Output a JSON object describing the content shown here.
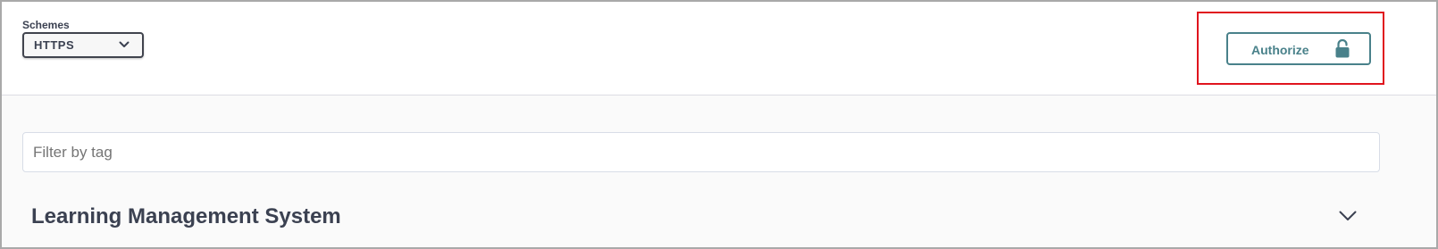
{
  "schemes": {
    "label": "Schemes",
    "selected": "HTTPS"
  },
  "auth": {
    "button_label": "Authorize",
    "icon": "unlocked-lock-icon"
  },
  "filter": {
    "placeholder": "Filter by tag",
    "value": ""
  },
  "tag_section": {
    "title": "Learning Management System",
    "expand_icon": "chevron-down-icon"
  },
  "colors": {
    "accent": "#49818a",
    "highlight": "#e0141e",
    "text": "#3b4151",
    "content_bg": "#fafafa"
  }
}
